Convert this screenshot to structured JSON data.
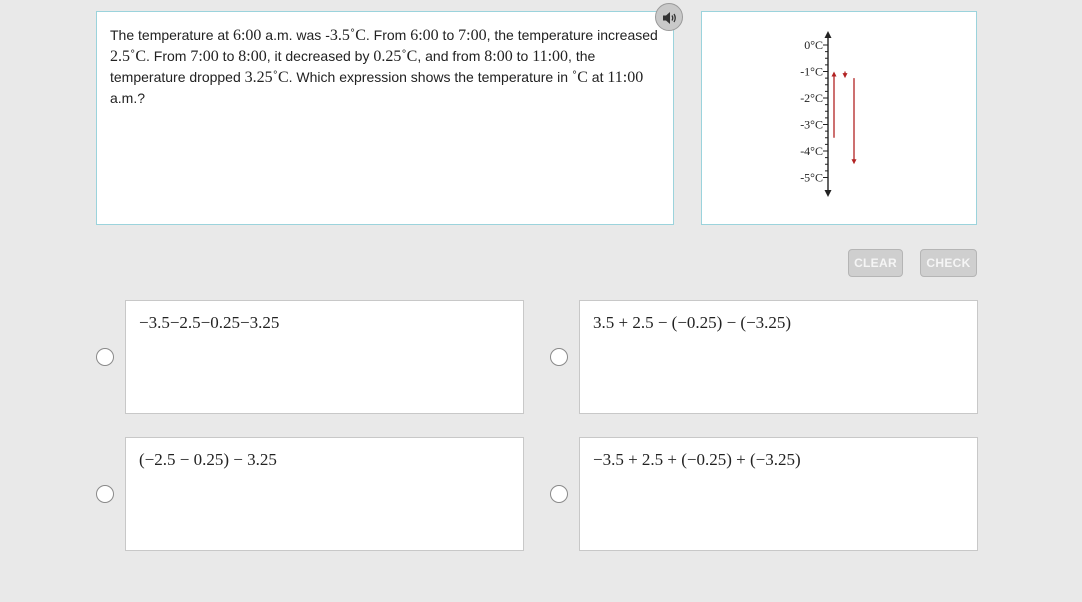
{
  "question": {
    "segments": [
      {
        "t": "The temperature at ",
        "math": false
      },
      {
        "t": "6:00",
        "math": true
      },
      {
        "t": " a.m. was -",
        "math": false
      },
      {
        "t": "3.5˚C",
        "math": true
      },
      {
        "t": ". From ",
        "math": false
      },
      {
        "t": "6:00",
        "math": true
      },
      {
        "t": " to ",
        "math": false
      },
      {
        "t": "7:00",
        "math": true
      },
      {
        "t": ", the temperature increased ",
        "math": false
      },
      {
        "t": "2.5˚C",
        "math": true
      },
      {
        "t": ". From ",
        "math": false
      },
      {
        "t": "7:00",
        "math": true
      },
      {
        "t": " to ",
        "math": false
      },
      {
        "t": "8:00",
        "math": true
      },
      {
        "t": ", it decreased by ",
        "math": false
      },
      {
        "t": "0.25˚C",
        "math": true
      },
      {
        "t": ", and from ",
        "math": false
      },
      {
        "t": "8:00",
        "math": true
      },
      {
        "t": " to ",
        "math": false
      },
      {
        "t": "11:00",
        "math": true
      },
      {
        "t": ", the temperature dropped ",
        "math": false
      },
      {
        "t": "3.25˚C",
        "math": true
      },
      {
        "t": ". Which expression shows the temperature in ",
        "math": false
      },
      {
        "t": "˚C",
        "math": true
      },
      {
        "t": " at ",
        "math": false
      },
      {
        "t": "11:00",
        "math": true
      },
      {
        "t": " a.m.?",
        "math": false
      }
    ]
  },
  "audio_button": {
    "icon": "speaker-icon"
  },
  "thermometer": {
    "labels": [
      "0°C",
      "-1°C",
      "-2°C",
      "-3°C",
      "-4°C",
      "-5°C"
    ],
    "arrow_color": "#b22222"
  },
  "buttons": {
    "clear": "CLEAR",
    "check": "CHECK"
  },
  "options": [
    {
      "text": "−3.5−2.5−0.25−3.25",
      "selected": false
    },
    {
      "text": "3.5 + 2.5 − (−0.25) − (−3.25)",
      "selected": false
    },
    {
      "text": "(−2.5 − 0.25) − 3.25",
      "selected": false
    },
    {
      "text": "−3.5 + 2.5 + (−0.25) + (−3.25)",
      "selected": false
    }
  ]
}
